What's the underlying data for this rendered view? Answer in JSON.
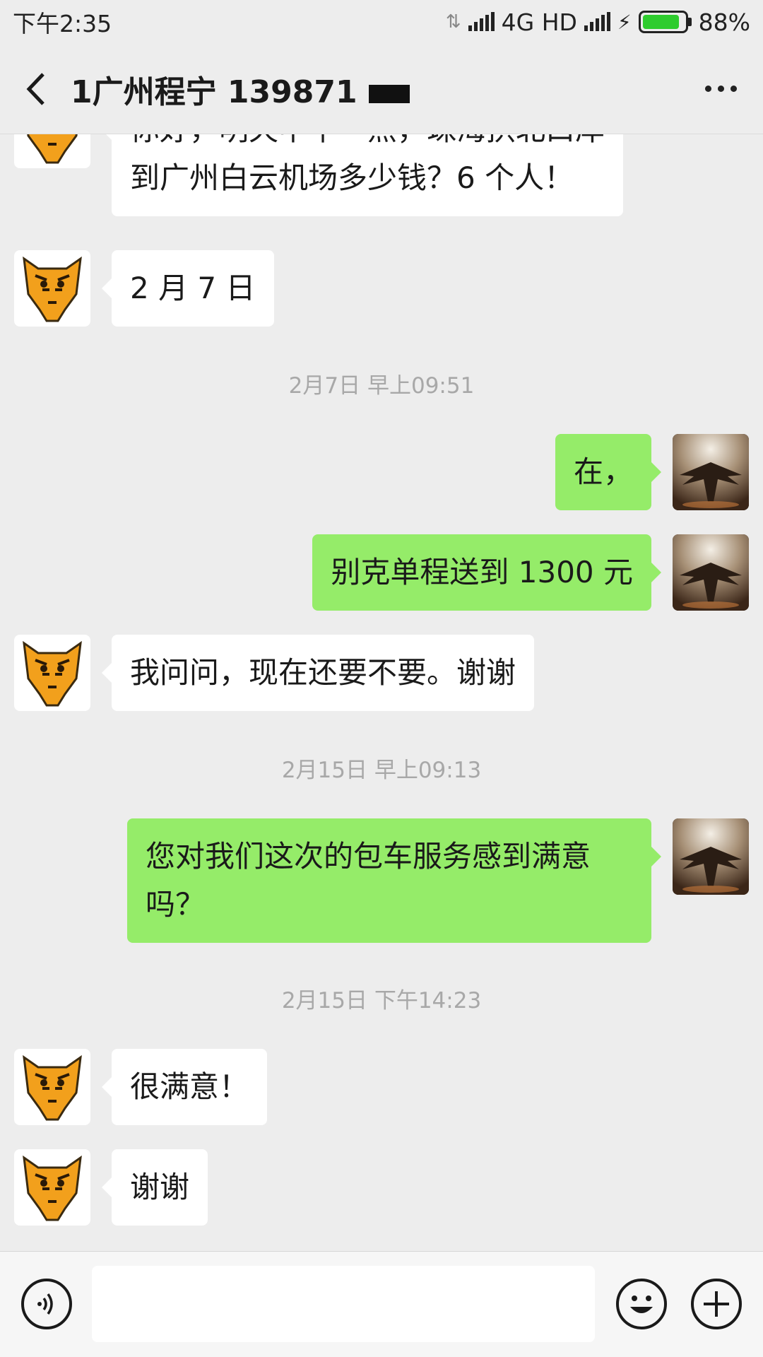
{
  "statusbar": {
    "time": "下午2:35",
    "network": "4G HD",
    "battery": "88%",
    "battery_level": 0.88,
    "battery_color": "#2ecc2e"
  },
  "header": {
    "title": "1广州程宁 139871"
  },
  "colors": {
    "bubble_sent": "#95ec69",
    "bubble_received": "#ffffff",
    "background": "#ededed"
  },
  "messages": [
    {
      "type": "received",
      "lines": [
        "你好，明天中午一点，珠海拱北口岸",
        "到广州白云机场多少钱？6 个人！"
      ]
    },
    {
      "type": "received",
      "text": "2 月 7 日"
    },
    {
      "type": "time",
      "text": "2月7日 早上09:51"
    },
    {
      "type": "sent",
      "text": "在，"
    },
    {
      "type": "sent",
      "text": "别克单程送到 1300 元"
    },
    {
      "type": "received",
      "text": "我问问，现在还要不要。谢谢"
    },
    {
      "type": "time",
      "text": "2月15日 早上09:13"
    },
    {
      "type": "sent",
      "lines": [
        "您对我们这次的包车服务感到满意",
        "吗？"
      ]
    },
    {
      "type": "time",
      "text": "2月15日 下午14:23"
    },
    {
      "type": "received",
      "text": "很满意！"
    },
    {
      "type": "received",
      "text": "谢谢"
    }
  ],
  "input": {
    "placeholder": ""
  }
}
